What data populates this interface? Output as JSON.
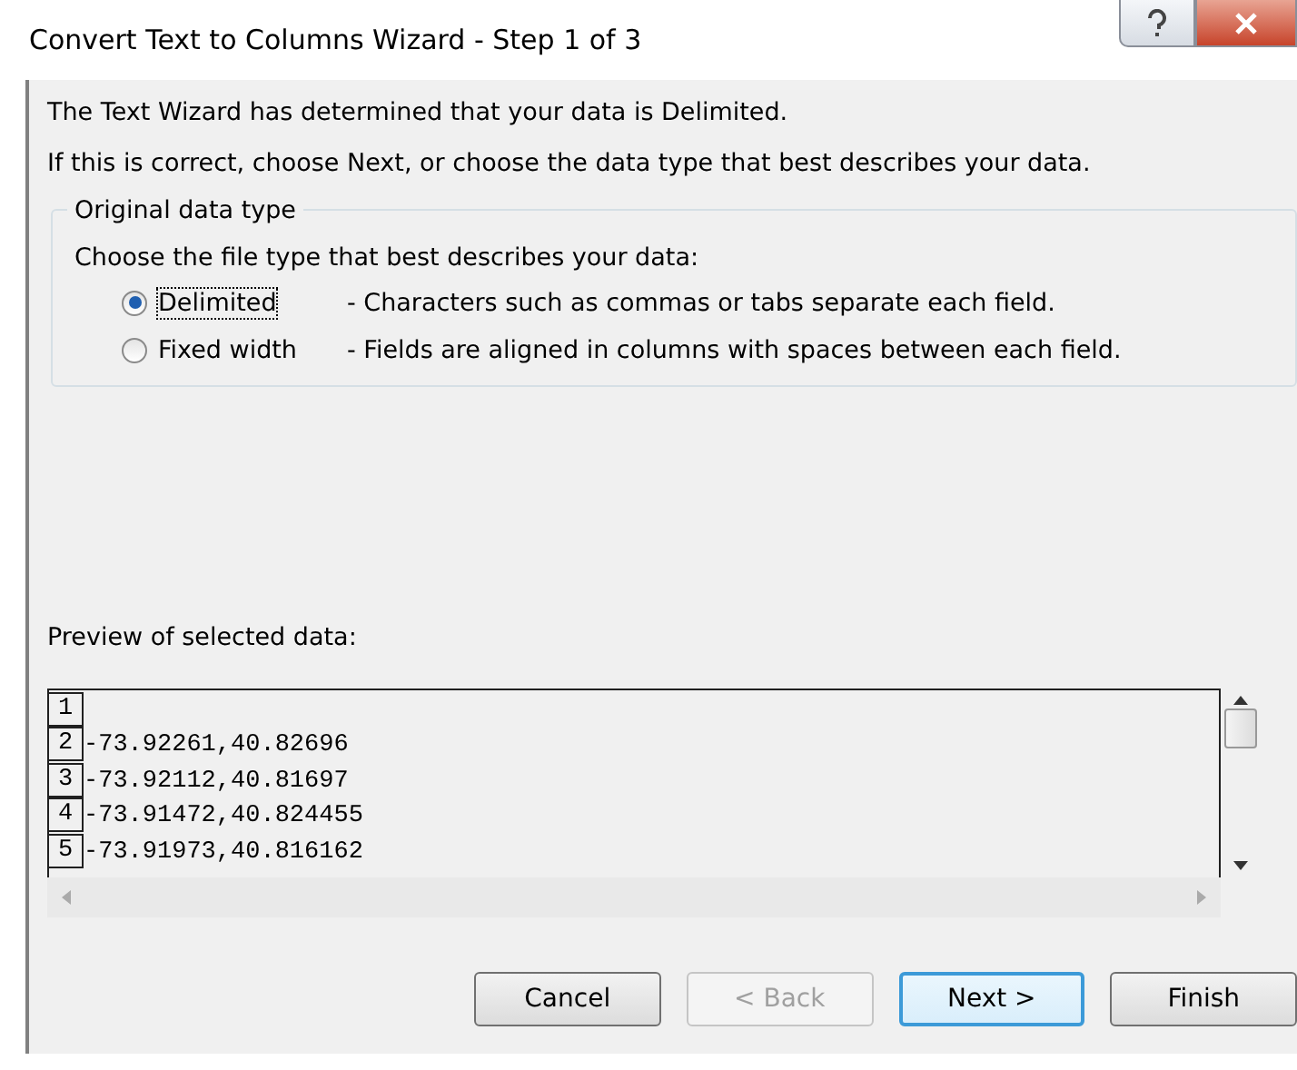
{
  "window": {
    "title": "Convert Text to Columns Wizard - Step 1 of 3"
  },
  "intro": [
    "The Text Wizard has determined that your data is Delimited.",
    "If this is correct, choose Next, or choose the data type that best describes your data."
  ],
  "data_type_group": {
    "title": "Original data type",
    "prompt": "Choose the file type that best describes your data:",
    "options": [
      {
        "label": "Delimited",
        "description": "- Characters such as commas or tabs separate each field.",
        "selected": true
      },
      {
        "label": "Fixed width",
        "description": "- Fields are aligned in columns with spaces between each field.",
        "selected": false
      }
    ]
  },
  "preview": {
    "label": "Preview of selected data:",
    "rows": [
      {
        "number": "1"
      },
      {
        "number": "2",
        "text": "-73.92261,40.82696"
      },
      {
        "number": "3",
        "text": "-73.92112,40.81697"
      },
      {
        "number": "4",
        "text": "-73.91472,40.824455"
      },
      {
        "number": "5",
        "text": "-73.91973,40.816162"
      }
    ]
  },
  "buttons": [
    {
      "label": "Cancel",
      "disabled": false,
      "default": false
    },
    {
      "label": "< Back",
      "disabled": true,
      "default": false
    },
    {
      "label": "Next >",
      "disabled": false,
      "default": true
    },
    {
      "label": "Finish",
      "disabled": false,
      "default": false
    }
  ]
}
